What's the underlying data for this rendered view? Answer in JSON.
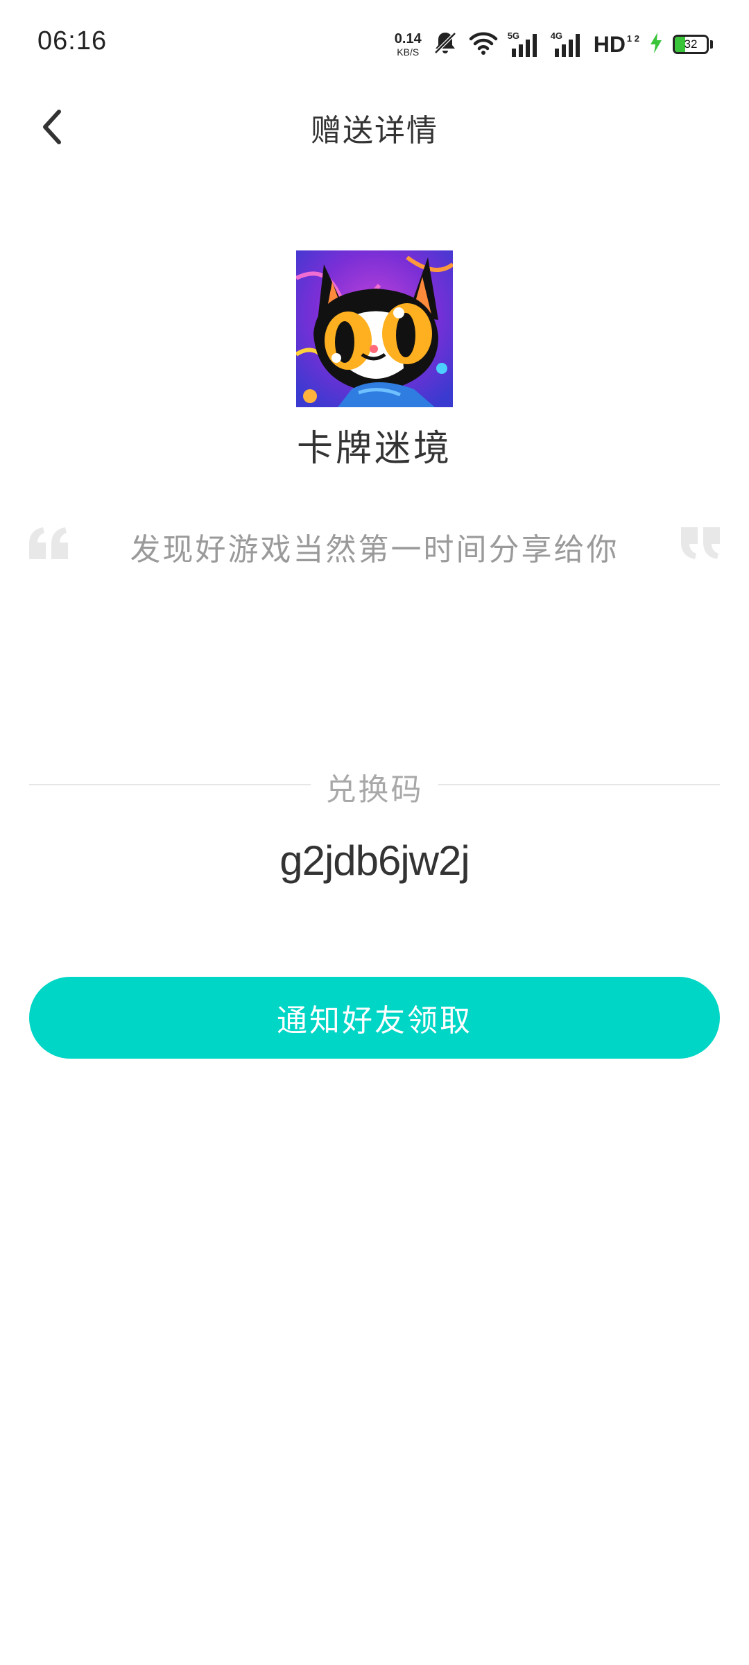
{
  "status_bar": {
    "time": "06:16",
    "net_speed_value": "0.14",
    "net_speed_unit": "KB/S",
    "sim1_tag": "5G",
    "sim2_tag": "4G",
    "hd_label": "HD",
    "hd_sub": "1 2",
    "battery_level": "32",
    "battery_fraction": 0.32,
    "icons": [
      "mute-bell-icon",
      "wifi-icon",
      "signal-5g-icon",
      "signal-4g-icon",
      "hd-icon",
      "charging-icon",
      "battery-icon"
    ]
  },
  "header": {
    "title": "赠送详情",
    "back_icon": "chevron-left-icon"
  },
  "game": {
    "name": "卡牌迷境",
    "icon": "cat-art-game-icon"
  },
  "quote": {
    "text": "发现好游戏当然第一时间分享给你"
  },
  "redeem": {
    "label": "兑换码",
    "code": "g2jdb6jw2j"
  },
  "action": {
    "notify_label": "通知好友领取"
  },
  "colors": {
    "accent": "#00d6c6",
    "text_primary": "#333333",
    "text_muted": "#9a9a9a",
    "divider": "#e6e6e6",
    "battery_green": "#39c43a"
  }
}
